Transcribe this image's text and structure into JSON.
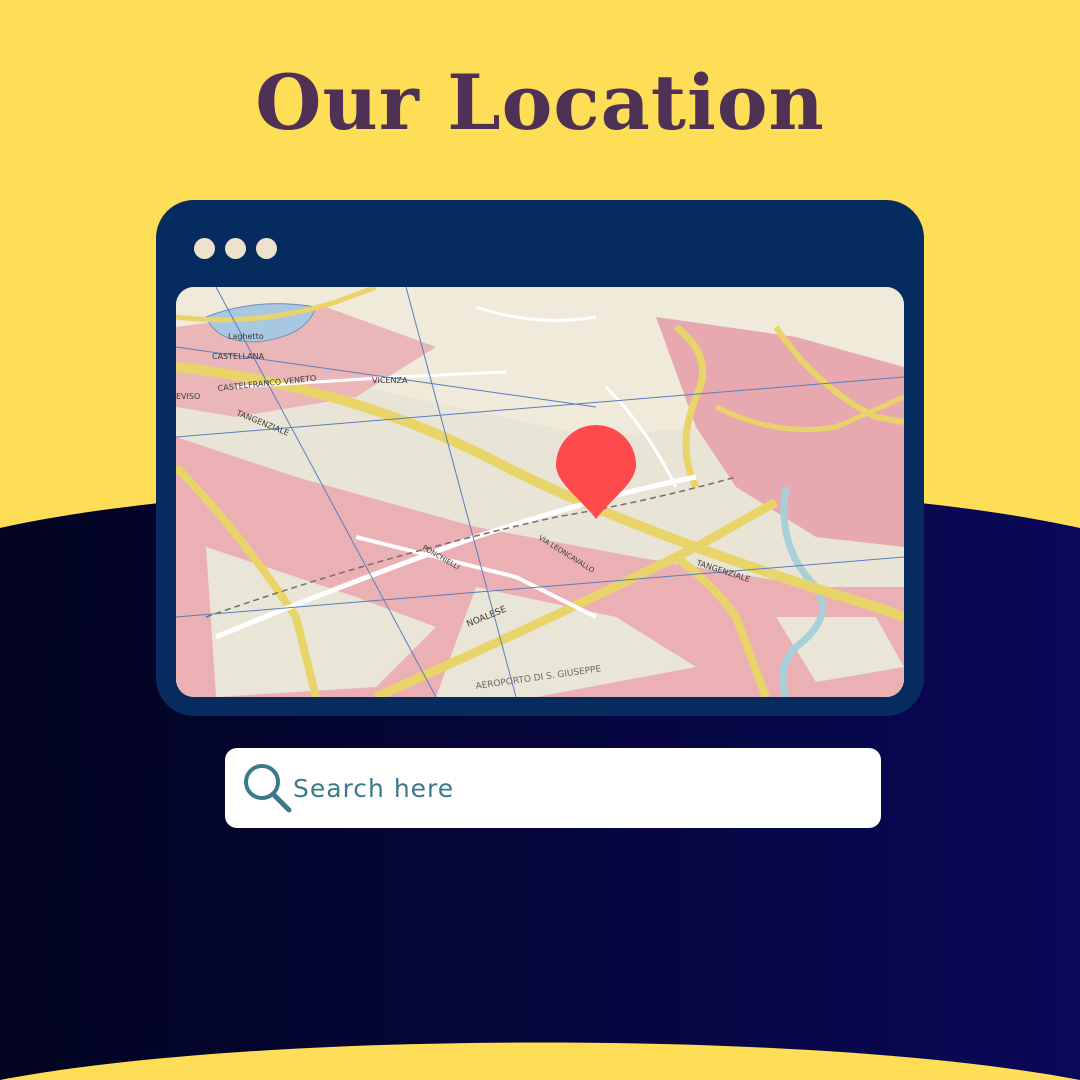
{
  "page": {
    "title": "Our Location",
    "colors": {
      "background": "#FEDD57",
      "wave_dark": "#020420",
      "wave_blue": "#0A0858",
      "title": "#4E3155",
      "window": "#062B5E",
      "dots": "#EDE3CC",
      "pin": "#FF4A4D",
      "search_text": "#3A7A8C"
    }
  },
  "window": {
    "controls": [
      "dot",
      "dot",
      "dot"
    ]
  },
  "map": {
    "marker_icon": "location-pin-icon",
    "labels": [
      "Laghetto",
      "CASTELLANA",
      "CASTELFRANCO VENETO",
      "VICENZA",
      "TANGENZIALE",
      "NOALESE",
      "VIA LEONCAVALLO",
      "PONCHIELLI",
      "AEROPORTO DI S. GIUSEPPE",
      "TANGENZIALE",
      "EVISO"
    ]
  },
  "search": {
    "placeholder": "Search here",
    "value": "",
    "icon": "search-icon"
  }
}
